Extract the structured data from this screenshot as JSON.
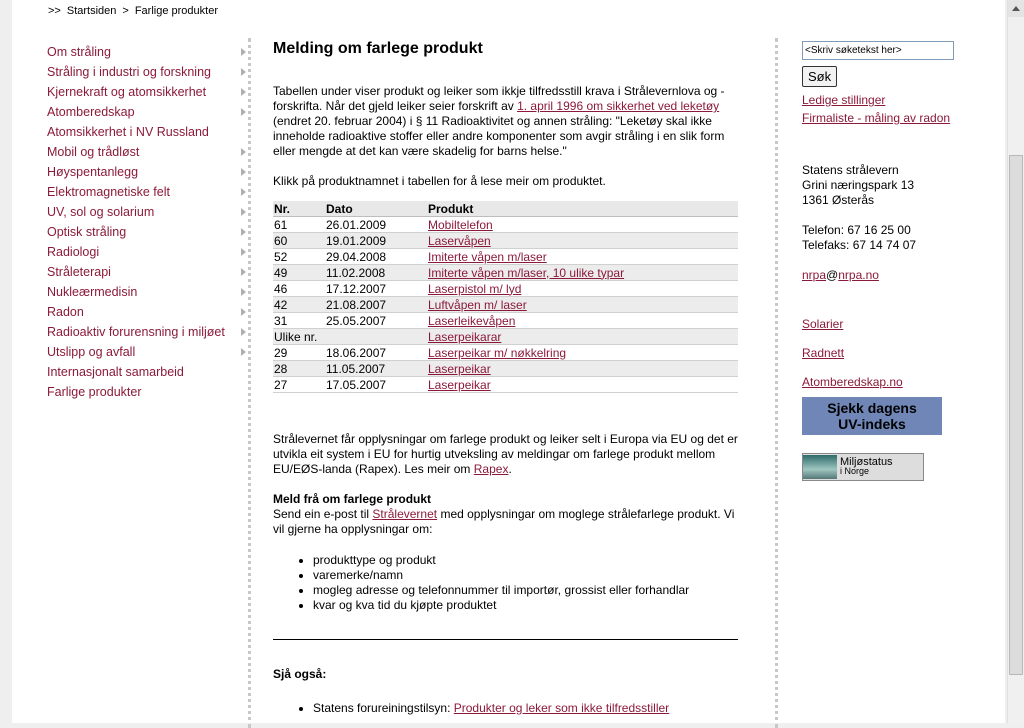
{
  "breadcrumb": {
    "sep": ">>",
    "home": "Startsiden",
    "sep2": ">",
    "current": "Farlige produkter"
  },
  "leftnav": [
    {
      "label": "Om stråling",
      "arrow": true
    },
    {
      "label": "Stråling i industri og forskning",
      "arrow": true
    },
    {
      "label": "Kjernekraft og atomsikkerhet",
      "arrow": true
    },
    {
      "label": "Atomberedskap",
      "arrow": true
    },
    {
      "label": "Atomsikkerhet i NV Russland",
      "arrow": false
    },
    {
      "label": "Mobil og trådløst",
      "arrow": true
    },
    {
      "label": "Høyspentanlegg",
      "arrow": true
    },
    {
      "label": "Elektromagnetiske felt",
      "arrow": true
    },
    {
      "label": "UV, sol og solarium",
      "arrow": true
    },
    {
      "label": "Optisk stråling",
      "arrow": true
    },
    {
      "label": "Radiologi",
      "arrow": true
    },
    {
      "label": "Stråleterapi",
      "arrow": true
    },
    {
      "label": "Nukleærmedisin",
      "arrow": true
    },
    {
      "label": "Radon",
      "arrow": true
    },
    {
      "label": "Radioaktiv forurensning i miljøet",
      "arrow": true
    },
    {
      "label": "Utslipp og avfall",
      "arrow": true
    },
    {
      "label": "Internasjonalt samarbeid",
      "arrow": false
    },
    {
      "label": "Farlige produkter",
      "arrow": false
    }
  ],
  "main": {
    "title": "Melding om farlege produkt",
    "intro_1": "Tabellen under viser produkt og leiker som ikkje tilfredsstill krava i Strålevernlova og -forskrifta. Når det gjeld leiker seier forskrift av ",
    "intro_link": "1. april 1996 om sikkerhet ved leketøy",
    "intro_2": " (endret 20. februar 2004) i  § 11 Radioaktivitet og annen stråling: \"Leketøy skal ikke inneholde radioaktive stoffer eller andre komponenter som avgir stråling i en slik form eller mengde at det kan være skadelig for barns helse.\"",
    "click_text": "Klikk på produktnamnet i tabellen for å lese meir om produktet.",
    "table_headers": [
      "Nr.",
      "Dato",
      "Produkt"
    ],
    "rows": [
      {
        "nr": "61",
        "date": "26.01.2009",
        "product": "Mobiltelefon"
      },
      {
        "nr": "60",
        "date": "19.01.2009",
        "product": "Laservåpen"
      },
      {
        "nr": "52",
        "date": "29.04.2008",
        "product": "Imiterte våpen m/laser"
      },
      {
        "nr": "49",
        "date": "11.02.2008",
        "product": "Imiterte våpen m/laser, 10 ulike typar"
      },
      {
        "nr": "46",
        "date": "17.12.2007",
        "product": "Laserpistol m/ lyd"
      },
      {
        "nr": "42",
        "date": "21.08.2007",
        "product": "Luftvåpen m/ laser"
      },
      {
        "nr": "31",
        "date": "25.05.2007",
        "product": "Laserleikevåpen"
      },
      {
        "nr": "Ulike nr.",
        "date": "",
        "product": "Laserpeikarar"
      },
      {
        "nr": "29",
        "date": "18.06.2007",
        "product": "Laserpeikar m/ nøkkelring "
      },
      {
        "nr": "28",
        "date": "11.05.2007",
        "product": "Laserpeikar"
      },
      {
        "nr": "27",
        "date": "17.05.2007",
        "product": "Laserpeikar"
      }
    ],
    "eu_text": "Strålevernet får opplysningar om farlege produkt og leiker selt i Europa via EU og det er utvikla eit system i EU for hurtig utveksling av meldingar om farlege produkt mellom EU/EØS-landa (Rapex). Les meir om ",
    "eu_link": "Rapex",
    "eu_end": ".",
    "report_heading": "Meld frå om farlege produkt",
    "report_1": "Send ein e-post til ",
    "report_link": "Strålevernet",
    "report_2": " med opplysningar om moglege strålefarlege produkt. Vi vil gjerne ha opplysningar om:",
    "bullets": [
      "produkttype og produkt",
      "varemerke/namn",
      "mogleg adresse og telefonnummer til importør, grossist eller forhandlar",
      "kvar og kva tid du kjøpte produktet"
    ],
    "see_also_heading": "Sjå også:",
    "see_also_prefix": "Statens forureiningstilsyn: ",
    "see_also_link": "Produkter og leker som ikke tilfredsstiller"
  },
  "right": {
    "search_value": "<Skriv søketekst her>",
    "search_button": "Søk",
    "link_jobs": "Ledige stillinger",
    "link_radon": "Firmaliste - måling av radon",
    "org_name": "Statens strålevern",
    "address_1": "Grini næringspark 13",
    "address_2": "1361 Østerås",
    "phone": "Telefon:  67 16 25 00",
    "fax": "Telefaks:  67 14 74 07",
    "email_user": "nrpa",
    "email_at": "@",
    "email_domain": "nrpa.no",
    "link_solarier": "Solarier",
    "link_radnett": "Radnett",
    "link_atom": "Atomberedskap.no",
    "uv_line1": "Sjekk dagens",
    "uv_line2": "UV-indeks",
    "uv_color": "#6f86b6",
    "miljo_line1": "Miljøstatus",
    "miljo_line2": "i Norge"
  }
}
